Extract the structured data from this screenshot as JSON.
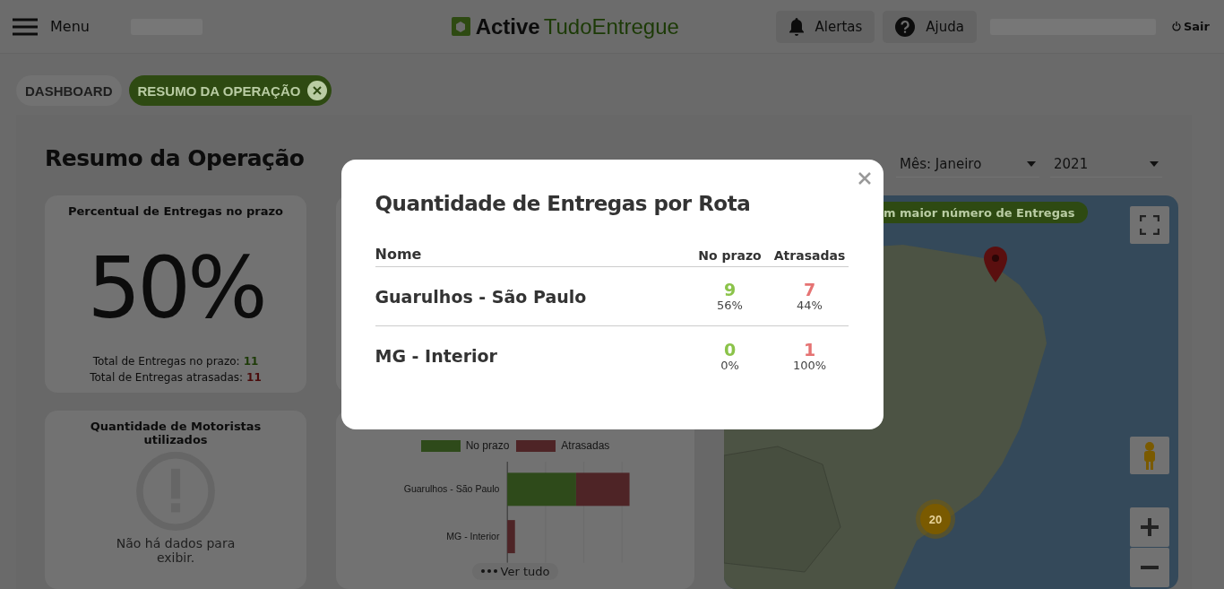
{
  "header": {
    "menu_label": "Menu",
    "logo": {
      "bold": "Active",
      "light": "TudoEntregue"
    },
    "buttons": [
      {
        "kind": "alert",
        "label": "Alertas"
      },
      {
        "kind": "help",
        "label": "Ajuda"
      }
    ],
    "logout": "Sair"
  },
  "tabs": [
    {
      "label": "DASHBOARD",
      "selected": false,
      "closable": false
    },
    {
      "label": "RESUMO DA OPERAÇÃO",
      "selected": true,
      "closable": true
    }
  ],
  "page": {
    "title": "Resumo da Operação",
    "month": {
      "label": "Mês:",
      "value": "Janeiro"
    },
    "year": {
      "value": "2021"
    }
  },
  "on_time_card": {
    "title": "Percentual de Entregas no prazo",
    "value": "50%",
    "totals": [
      {
        "label": "Total de Entregas no prazo:",
        "value": "11",
        "kind": "ok"
      },
      {
        "label": "Total de Entregas atrasadas:",
        "value": "11",
        "kind": "late"
      }
    ]
  },
  "drivers_card": {
    "title": "Quantidade de Motoristas utilizados",
    "empty_message": "Não há dados para exibir."
  },
  "route_chart": {
    "more_label": "Ver tudo",
    "legend": [
      {
        "name": "No prazo",
        "color": "#2e4a1a"
      },
      {
        "name": "Atrasadas",
        "color": "#4e2426"
      }
    ],
    "categories": [
      "Guarulhos - São Paulo",
      "MG - Interior"
    ]
  },
  "map": {
    "banner": "m maior número de Entregas",
    "cluster": "20"
  },
  "modal": {
    "title": "Quantidade de Entregas por Rota",
    "columns": [
      "Nome",
      "No prazo",
      "Atrasadas"
    ],
    "rows": [
      {
        "name": "Guarulhos - São Paulo",
        "on_time": "9",
        "on_time_pct": "56%",
        "late": "7",
        "late_pct": "44%"
      },
      {
        "name": "MG - Interior",
        "on_time": "0",
        "on_time_pct": "0%",
        "late": "1",
        "late_pct": "100%"
      }
    ]
  }
}
